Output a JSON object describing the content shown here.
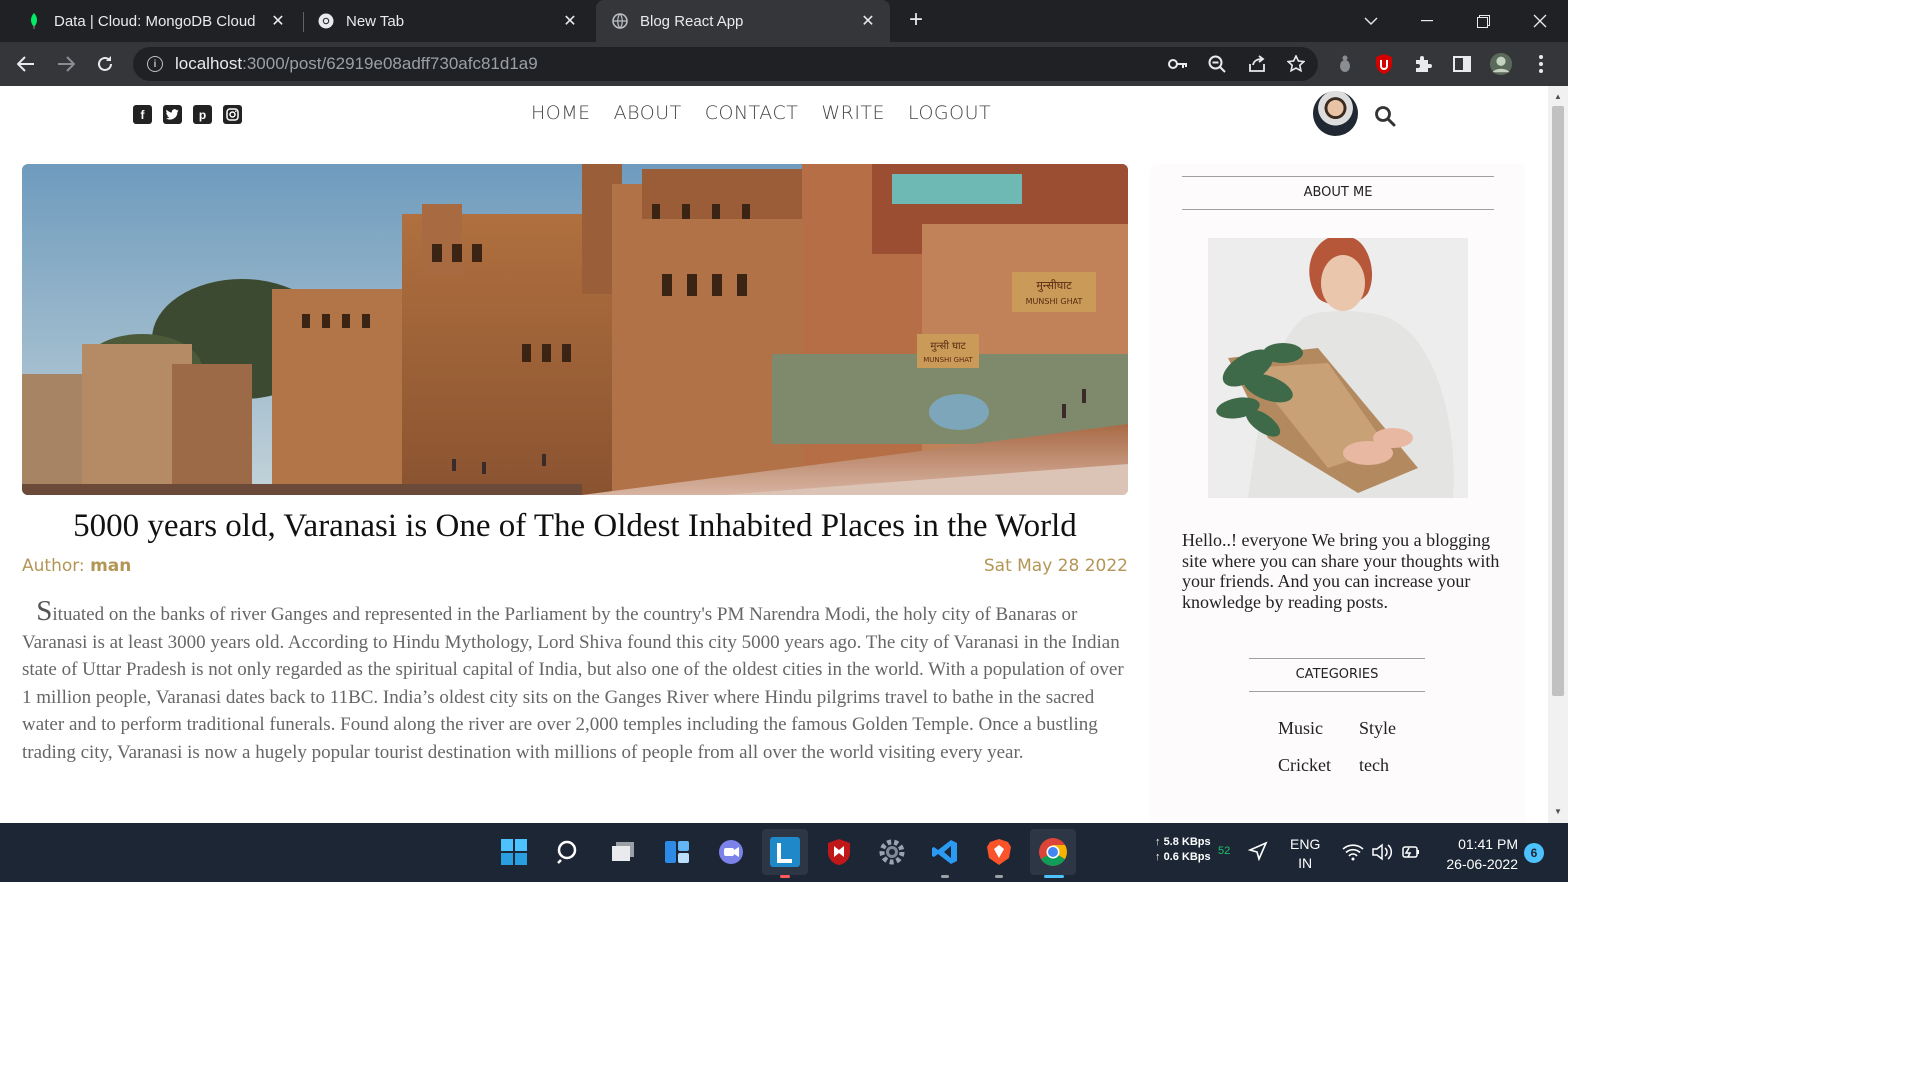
{
  "browser": {
    "tabs": [
      {
        "title": "Data | Cloud: MongoDB Cloud",
        "icon": "mongodb-leaf-icon",
        "active": false
      },
      {
        "title": "New Tab",
        "icon": "chrome-icon",
        "active": false
      },
      {
        "title": "Blog React App",
        "icon": "globe-icon",
        "active": true
      }
    ],
    "url_host": "localhost",
    "url_path": ":3000/post/62919e08adff730afc81d1a9"
  },
  "blog": {
    "nav": [
      "HOME",
      "ABOUT",
      "CONTACT",
      "WRITE",
      "LOGOUT"
    ],
    "social_icons": [
      "facebook-icon",
      "twitter-icon",
      "pinterest-icon",
      "instagram-icon"
    ],
    "post": {
      "title": "5000 years old, Varanasi is One of The Oldest Inhabited Places in the World",
      "author_label": "Author: ",
      "author": "man",
      "date": "Sat May 28 2022",
      "first_letter": "S",
      "body": "ituated on the banks of river Ganges and represented in the Parliament by the country's PM Narendra Modi, the holy city of Banaras or Varanasi is at least 3000 years old. According to Hindu Mythology, Lord Shiva found this city 5000 years ago. The city of Varanasi in the Indian state of Uttar Pradesh is not only regarded as the spiritual capital of India, but also one of the oldest cities in the world. With a population of over 1 million people, Varanasi dates back to 11BC. India’s oldest city sits on the Ganges River where Hindu pilgrims travel to bathe in the sacred water and to perform traditional funerals. Found along the river are over 2,000 temples including the famous Golden Temple. Once a bustling trading city, Varanasi is now a hugely popular tourist destination with millions of people from all over the world visiting every year.",
      "hero_sign_1": "मुन्सी घाट",
      "hero_sign_1_en": "MUNSHI GHAT",
      "hero_sign_2": "मुन्सीघाट",
      "hero_sign_2_en": "MUNSHI GHAT"
    },
    "sidebar": {
      "about_title": "ABOUT ME",
      "about_text": "Hello..! everyone We bring you a blogging site where you can share your thoughts with your friends. And you can increase your knowledge by reading posts.",
      "categories_title": "CATEGORIES",
      "categories": [
        "Music",
        "Style",
        "Cricket",
        "tech"
      ]
    }
  },
  "taskbar": {
    "net_up": "5.8 KBps",
    "net_down": "0.6 KBps",
    "net_extra": "52",
    "lang_1": "ENG",
    "lang_2": "IN",
    "time": "01:41 PM",
    "date": "26-06-2022",
    "notifications": "6"
  }
}
